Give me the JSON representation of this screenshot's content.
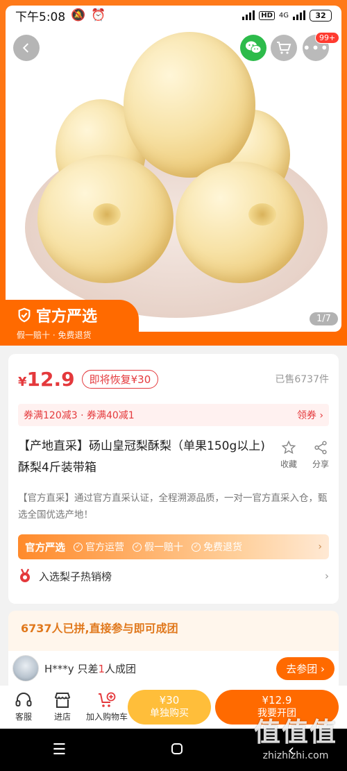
{
  "status_bar": {
    "time": "下午5:08",
    "network": "4G",
    "battery": "32"
  },
  "header": {
    "cart_badge": "99+"
  },
  "hero": {
    "banner_title": "官方严选",
    "banner_subtitle": "假一赔十 · 免费退货",
    "pager": "1/7"
  },
  "price": {
    "symbol": "¥",
    "value": "12.9",
    "restore_tag": "即将恢复¥30",
    "sold": "已售6737件"
  },
  "coupon": {
    "text": "券满120减3 · 券满40减1",
    "get_label": "领券"
  },
  "product": {
    "title": "【产地直采】砀山皇冠梨酥梨（单果150g以上) 酥梨4斤装带箱",
    "collect_label": "收藏",
    "share_label": "分享",
    "description": "【官方直采】通过官方直采认证，全程溯源品质，一对一官方直采入仓，甄选全国优选产地！"
  },
  "official_strip": {
    "brand": "官方严选",
    "items": [
      "官方运营",
      "假一赔十",
      "免费退货"
    ]
  },
  "hot_rank": {
    "label": "入选梨子热销榜"
  },
  "group": {
    "headline": "6737人已拼,直接参与即可成团",
    "user_name": "H***y",
    "user_text_pre": "只差",
    "user_count": "1",
    "user_text_post": "人成团",
    "join_label": "去参团"
  },
  "bottom_bar": {
    "service": "客服",
    "store": "进店",
    "add_cart": "加入购物车",
    "solo_price": "¥30",
    "solo_label": "单独购买",
    "group_price": "¥12.9",
    "group_label": "我要开团"
  },
  "watermark": {
    "big": "值值值",
    "small": "zhizhizhi.com"
  },
  "colors": {
    "accent": "#ff6a00",
    "price_red": "#e4393c",
    "wechat_green": "#2dbb4b",
    "solo_yellow": "#ffbe3a"
  }
}
